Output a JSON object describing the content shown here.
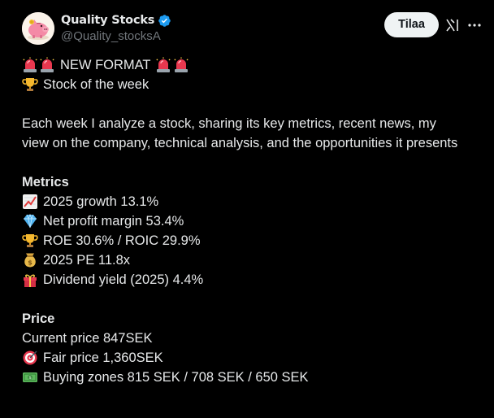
{
  "author": {
    "display_name": "Quality Stocks",
    "handle": "@Quality_stocksA",
    "verified": true
  },
  "actions": {
    "subscribe_label": "Tilaa"
  },
  "post": {
    "headline": "NEW FORMAT",
    "subtitle": "Stock of the week",
    "intro": "Each week I analyze a stock, sharing its key metrics, recent news, my view on the company, technical analysis, and the opportunities it presents",
    "metrics_heading": "Metrics",
    "metrics": [
      {
        "icon": "chart-increasing-icon",
        "text": "2025 growth 13.1%"
      },
      {
        "icon": "gem-icon",
        "text": "Net profit margin 53.4%"
      },
      {
        "icon": "trophy-icon",
        "text": "ROE 30.6% / ROIC 29.9%"
      },
      {
        "icon": "money-bag-icon",
        "text": "2025 PE 11.8x"
      },
      {
        "icon": "gift-icon",
        "text": "Dividend yield (2025) 4.4%"
      }
    ],
    "price_heading": "Price",
    "current_price": "Current price 847SEK",
    "fair_price": "Fair price 1,360SEK",
    "buying_zones": "Buying zones 815 SEK / 708 SEK / 650 SEK"
  },
  "colors": {
    "background": "#000000",
    "text": "#e7e9ea",
    "secondary_text": "#71767b",
    "verified_blue": "#1d9bf0",
    "button_bg": "#eff3f4"
  }
}
